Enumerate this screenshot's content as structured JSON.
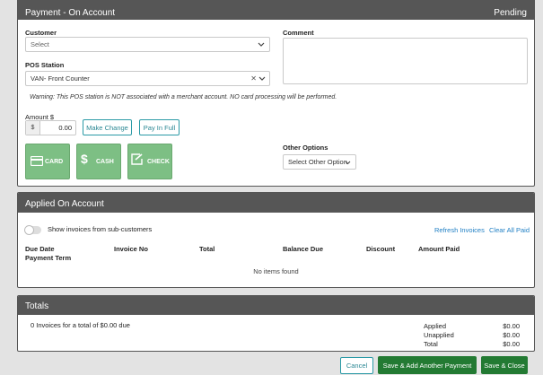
{
  "payment": {
    "title": "Payment - On Account",
    "status": "Pending",
    "customer_label": "Customer",
    "customer_placeholder": "Select",
    "comment_label": "Comment",
    "pos_label": "POS Station",
    "pos_value": "VAN- Front Counter",
    "warning": "Warning: This POS station is NOT associated with a merchant account. NO card processing will be performed.",
    "amount_label": "Amount $",
    "currency_symbol": "$",
    "amount_value": "0.00",
    "make_change": "Make Change",
    "pay_in_full": "Pay In Full",
    "buttons": {
      "card": "CARD",
      "cash": "CASH",
      "check": "CHECK",
      "cash_glyph": "$"
    },
    "other_options_label": "Other Options",
    "other_options_value": "Select Other Option"
  },
  "applied": {
    "title": "Applied On Account",
    "toggle_label": "Show invoices from sub-customers",
    "refresh": "Refresh Invoices",
    "clear": "Clear All Paid",
    "columns": {
      "due_date": "Due Date",
      "payment_term": "Payment Term",
      "invoice_no": "Invoice No",
      "total": "Total",
      "balance_due": "Balance Due",
      "discount": "Discount",
      "amount_paid": "Amount Paid"
    },
    "empty": "No items found"
  },
  "totals": {
    "title": "Totals",
    "summary": "0 Invoices for a total of $0.00 due",
    "applied_label": "Applied",
    "applied_value": "$0.00",
    "unapplied_label": "Unapplied",
    "unapplied_value": "$0.00",
    "total_label": "Total",
    "total_value": "$0.00"
  },
  "footer": {
    "cancel": "Cancel",
    "save_add": "Save & Add Another Payment",
    "save_close": "Save & Close"
  }
}
